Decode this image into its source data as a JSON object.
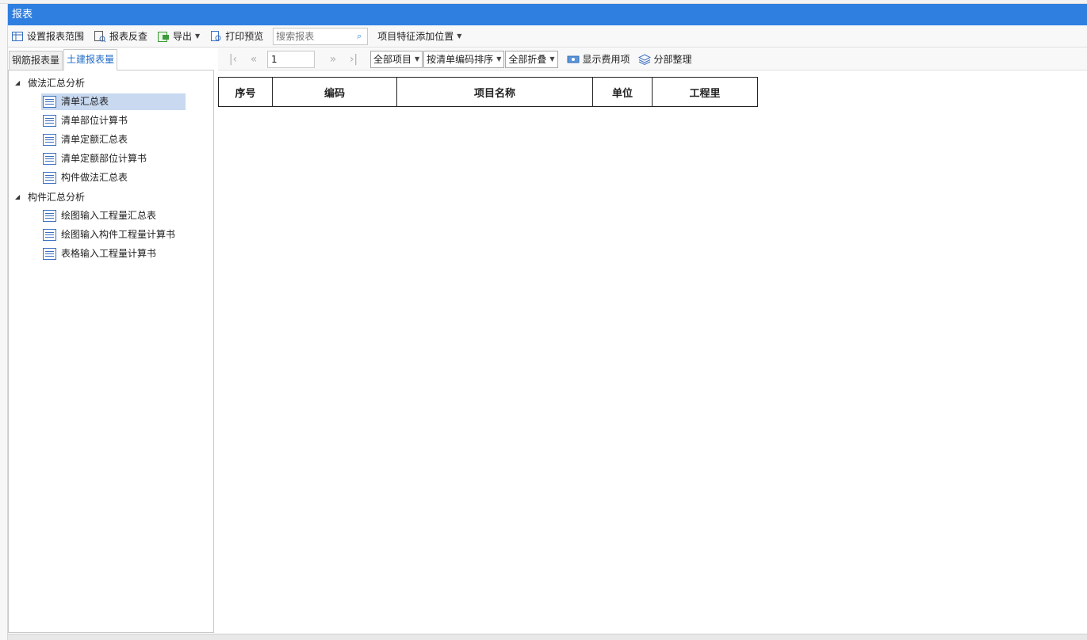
{
  "window": {
    "title": "报表"
  },
  "toolbar": {
    "set_range": "设置报表范围",
    "reverse_check": "报表反查",
    "export": "导出",
    "print_preview": "打印预览",
    "search_placeholder": "搜索报表",
    "feature_position": "项目特征添加位置"
  },
  "tabs": [
    "钢筋报表量",
    "土建报表量"
  ],
  "tree": {
    "groups": [
      {
        "label": "做法汇总分析",
        "items": [
          "清单汇总表",
          "清单部位计算书",
          "清单定额汇总表",
          "清单定额部位计算书",
          "构件做法汇总表"
        ]
      },
      {
        "label": "构件汇总分析",
        "items": [
          "绘图输入工程量汇总表",
          "绘图输入构件工程量计算书",
          "表格输入工程量计算书"
        ]
      }
    ]
  },
  "report_toolbar": {
    "page": "1",
    "filter": "全部项目",
    "sort": "按清单编码排序",
    "fold": "全部折叠",
    "show_fee": "显示费用项",
    "organize": "分部整理"
  },
  "table": {
    "headers": [
      "序号",
      "编码",
      "项目名称",
      "单位",
      "工程里"
    ]
  },
  "colors": {
    "titlebar": "#2f7fe0",
    "selected": "#c8d9f0",
    "accent_tab": "#1f6cc8"
  }
}
